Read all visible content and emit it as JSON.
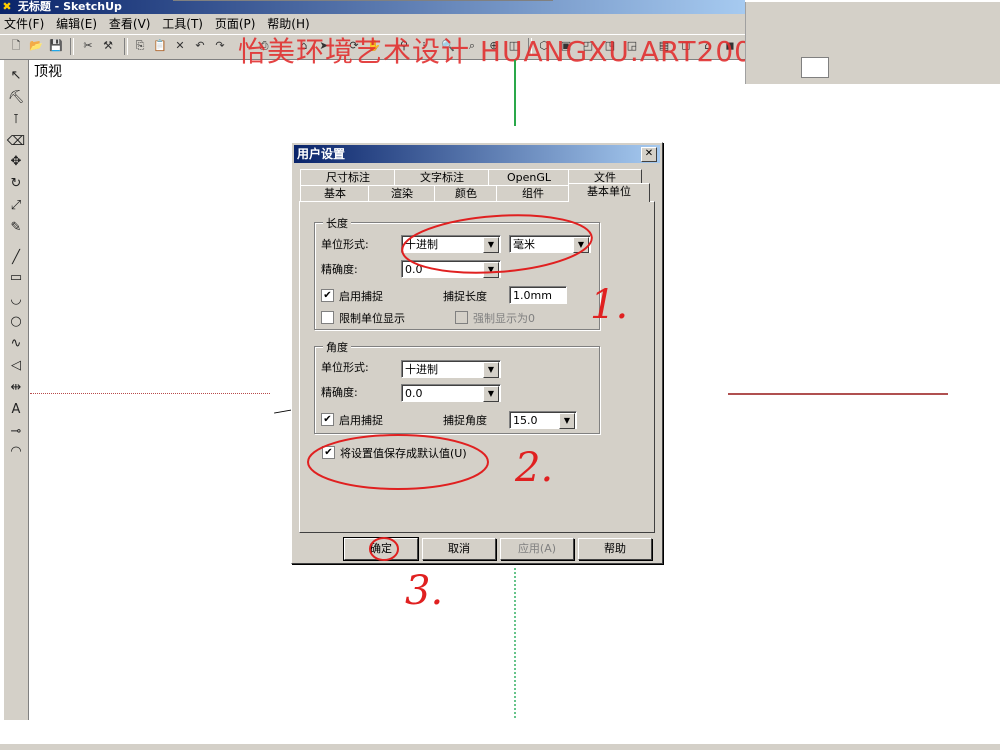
{
  "window": {
    "title": "无标题 - SketchUp"
  },
  "menu": [
    "文件(F)",
    "编辑(E)",
    "查看(V)",
    "工具(T)",
    "页面(P)",
    "帮助(H)"
  ],
  "watermark": "怡美环境艺术设计 HUANGXU.ART200",
  "viewport": {
    "view_label": "顶视"
  },
  "dialog": {
    "title": "用户设置",
    "close_glyph": "✕",
    "tabs_row1": [
      "尺寸标注",
      "文字标注",
      "OpenGL",
      "文件"
    ],
    "tabs_row2": [
      "基本",
      "渲染",
      "颜色",
      "组件",
      "基本单位"
    ],
    "selected_tab": "基本单位",
    "length": {
      "group_label": "长度",
      "unit_format_label": "单位形式:",
      "unit_format_value": "十进制",
      "unit_value": "毫米",
      "precision_label": "精确度:",
      "precision_value": "0.0",
      "enable_snap_label": "启用捕捉",
      "enable_snap_checked": true,
      "snap_length_label": "捕捉长度",
      "snap_length_value": "1.0mm",
      "restrict_unit_label": "限制单位显示",
      "restrict_unit_checked": false,
      "force_zero_label": "强制显示为0",
      "force_zero_checked": false
    },
    "angle": {
      "group_label": "角度",
      "unit_format_label": "单位形式:",
      "unit_format_value": "十进制",
      "precision_label": "精确度:",
      "precision_value": "0.0",
      "enable_snap_label": "启用捕捉",
      "enable_snap_checked": true,
      "snap_angle_label": "捕捉角度",
      "snap_angle_value": "15.0"
    },
    "save_default_label": "将设置值保存成默认值(U)",
    "save_default_checked": true,
    "buttons": {
      "ok": "确定",
      "cancel": "取消",
      "apply": "应用(A)",
      "help": "帮助"
    }
  },
  "annotations": {
    "step1": "1.",
    "step2": "2.",
    "step3": "3."
  },
  "colors": {
    "annotation_red": "#e02020",
    "axis_green": "#2aa84a",
    "axis_red": "#b05050",
    "titlebar": "#0a246a"
  }
}
